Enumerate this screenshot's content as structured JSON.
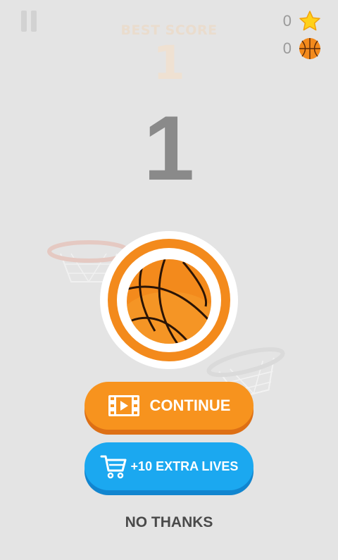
{
  "best_score": {
    "label": "BEST SCORE",
    "value": "1"
  },
  "counters": {
    "stars": "0",
    "balls": "0"
  },
  "score": "1",
  "buttons": {
    "continue_label": "CONTINUE",
    "extra_lives_label": "+10 EXTRA LIVES",
    "no_thanks_label": "NO THANKS"
  },
  "icons": {
    "pause": "pause-icon",
    "star": "star-icon",
    "ball": "basketball-icon",
    "video": "video-icon",
    "cart": "shopping-cart-icon"
  },
  "colors": {
    "background": "#e4e4e4",
    "continue_button": "#f7931e",
    "extra_lives_button": "#1ba8f0",
    "ball": "#f38a1c",
    "score_text": "#8a8a8a"
  }
}
